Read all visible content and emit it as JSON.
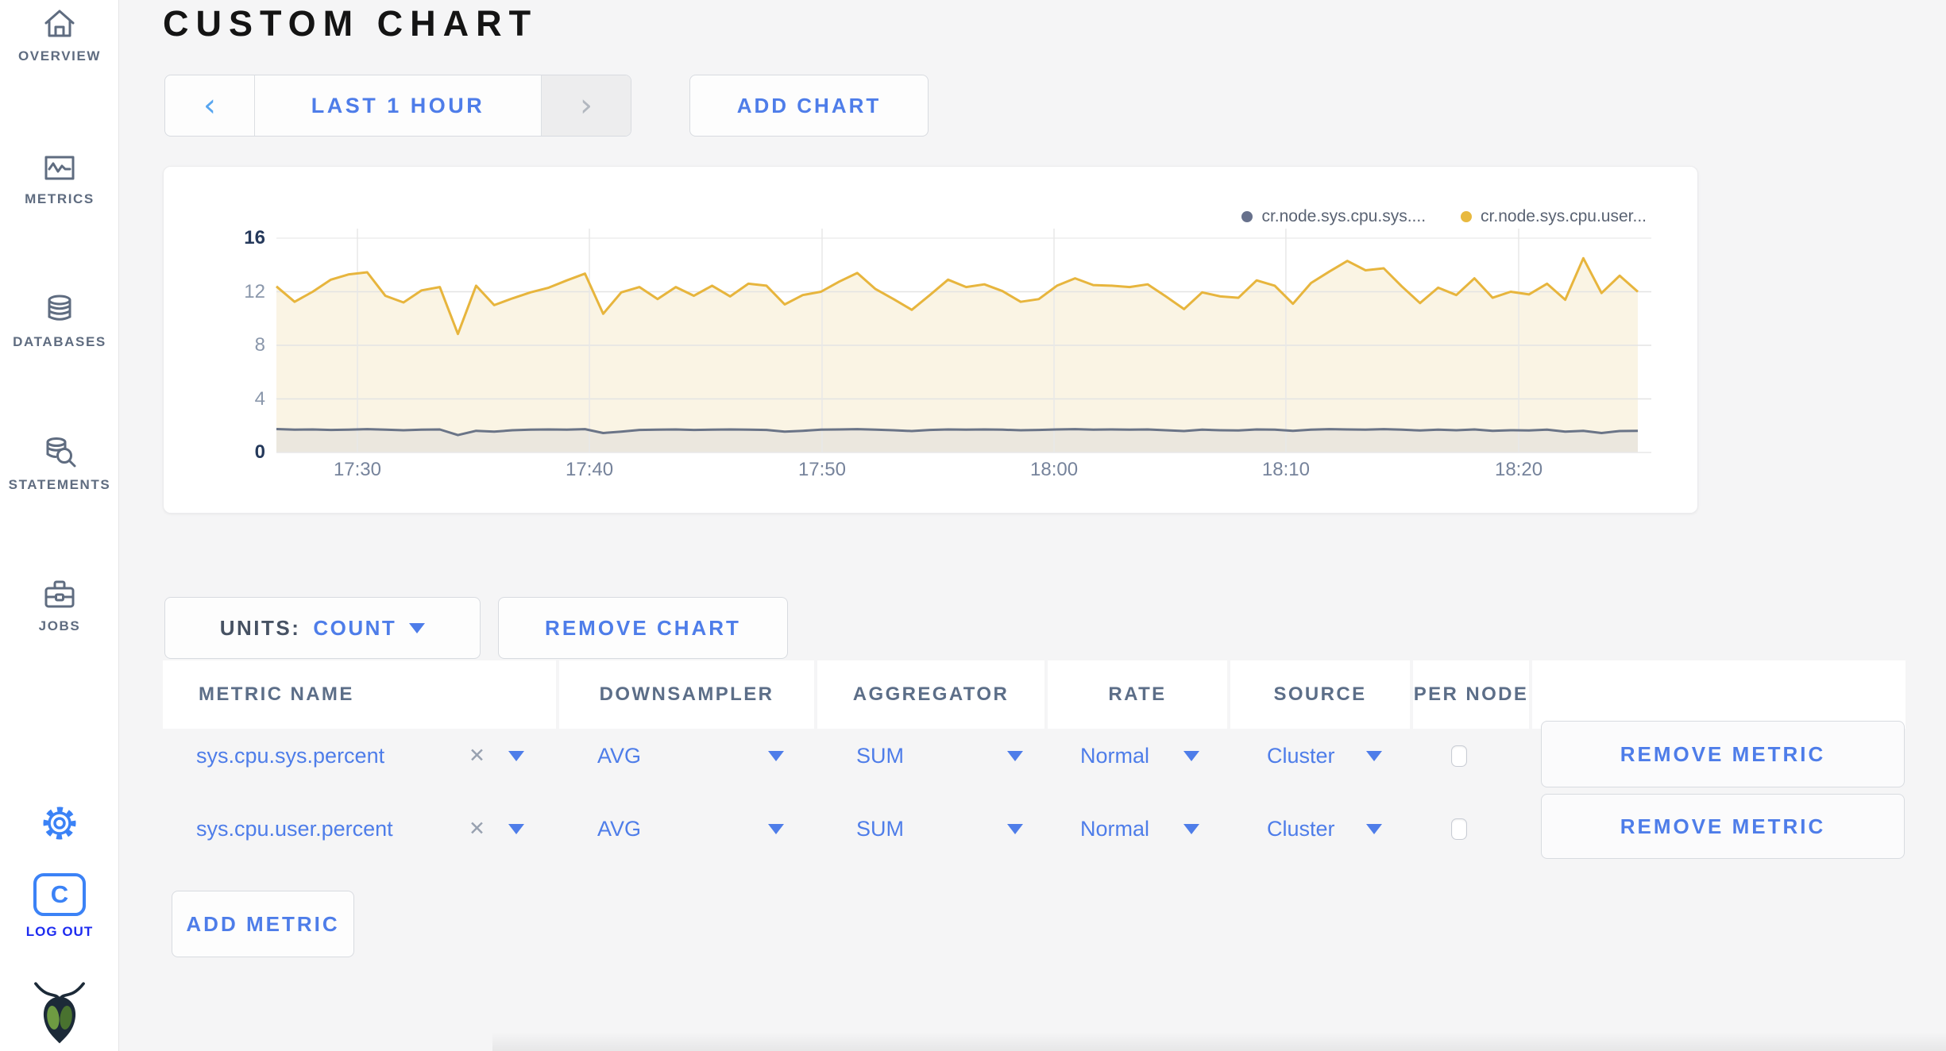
{
  "header": {
    "title": "CUSTOM CHART"
  },
  "sidebar": {
    "items": [
      {
        "label": "OVERVIEW",
        "icon": "home-icon"
      },
      {
        "label": "METRICS",
        "icon": "metrics-icon"
      },
      {
        "label": "DATABASES",
        "icon": "database-icon"
      },
      {
        "label": "STATEMENTS",
        "icon": "statements-icon"
      },
      {
        "label": "JOBS",
        "icon": "briefcase-icon"
      }
    ],
    "logout_monogram": "C",
    "logout_label": "LOG OUT"
  },
  "icons": {
    "prev_glyph": "‹",
    "next_glyph": "›",
    "remove_glyph": "✕"
  },
  "time_selector": {
    "label": "LAST 1 HOUR"
  },
  "add_chart_label": "ADD CHART",
  "units": {
    "prefix": "UNITS:",
    "value": "COUNT"
  },
  "remove_chart_label": "REMOVE CHART",
  "add_metric_label": "ADD METRIC",
  "colors": {
    "accent_blue": "#4e7de9",
    "bright_blue": "#3b82f6",
    "logout_blue": "#1d2bf0",
    "slate": "#5f6c80",
    "user_line": "#e7b53d",
    "user_fill": "#faf4e4",
    "sys_line": "#6a7487",
    "sys_fill": "#ebe7de"
  },
  "chart_data": {
    "type": "area",
    "title": "",
    "xlabel": "",
    "ylabel": "",
    "x_ticks": [
      "17:30",
      "17:40",
      "17:50",
      "18:00",
      "18:10",
      "18:20"
    ],
    "x_tick_fractions": [
      0.0595,
      0.2299,
      0.4008,
      0.5712,
      0.7415,
      0.9125
    ],
    "y_ticks": [
      0,
      4,
      8,
      12,
      16
    ],
    "ylim": [
      0,
      16
    ],
    "grid": true,
    "legend_position": "top-right",
    "series": [
      {
        "name": "cr.node.sys.cpu.sys....",
        "color": "#6a7487",
        "fill": "#ebe7de",
        "dot": "#67718c",
        "values": [
          1.75,
          1.7,
          1.72,
          1.68,
          1.7,
          1.74,
          1.7,
          1.66,
          1.7,
          1.72,
          1.3,
          1.62,
          1.55,
          1.66,
          1.7,
          1.72,
          1.7,
          1.74,
          1.45,
          1.55,
          1.68,
          1.7,
          1.72,
          1.68,
          1.7,
          1.72,
          1.7,
          1.68,
          1.55,
          1.62,
          1.7,
          1.72,
          1.74,
          1.7,
          1.66,
          1.6,
          1.68,
          1.72,
          1.7,
          1.72,
          1.7,
          1.66,
          1.68,
          1.72,
          1.74,
          1.7,
          1.72,
          1.7,
          1.72,
          1.66,
          1.6,
          1.7,
          1.66,
          1.64,
          1.72,
          1.7,
          1.62,
          1.7,
          1.74,
          1.72,
          1.7,
          1.74,
          1.7,
          1.64,
          1.7,
          1.66,
          1.72,
          1.62,
          1.66,
          1.64,
          1.7,
          1.56,
          1.62,
          1.45,
          1.6,
          1.62
        ]
      },
      {
        "name": "cr.node.sys.cpu.user...",
        "color": "#e7b53d",
        "fill": "#faf4e4",
        "dot": "#e8b93f",
        "values": [
          12.4,
          11.25,
          12.0,
          12.9,
          13.3,
          13.45,
          11.7,
          11.2,
          12.1,
          12.35,
          8.85,
          12.45,
          11.0,
          11.5,
          11.95,
          12.3,
          12.85,
          13.35,
          10.35,
          11.95,
          12.35,
          11.45,
          12.35,
          11.7,
          12.45,
          11.65,
          12.6,
          12.45,
          11.05,
          11.75,
          12.0,
          12.75,
          13.4,
          12.2,
          11.45,
          10.65,
          11.75,
          12.9,
          12.35,
          12.55,
          12.05,
          11.25,
          11.45,
          12.45,
          13.0,
          12.5,
          12.45,
          12.35,
          12.55,
          11.65,
          10.7,
          11.95,
          11.65,
          11.55,
          12.85,
          12.45,
          11.1,
          12.65,
          13.5,
          14.3,
          13.6,
          13.75,
          12.4,
          11.15,
          12.3,
          11.75,
          13.0,
          11.55,
          12.0,
          11.8,
          12.6,
          11.4,
          14.5,
          11.9,
          13.2,
          12.0
        ]
      }
    ]
  },
  "table": {
    "headers": [
      "METRIC NAME",
      "DOWNSAMPLER",
      "AGGREGATOR",
      "RATE",
      "SOURCE",
      "PER NODE",
      ""
    ],
    "rows": [
      {
        "metric": "sys.cpu.sys.percent",
        "downsampler": "AVG",
        "aggregator": "SUM",
        "rate": "Normal",
        "source": "Cluster",
        "per_node_checked": false,
        "remove_label": "REMOVE METRIC"
      },
      {
        "metric": "sys.cpu.user.percent",
        "downsampler": "AVG",
        "aggregator": "SUM",
        "rate": "Normal",
        "source": "Cluster",
        "per_node_checked": false,
        "remove_label": "REMOVE METRIC"
      }
    ]
  }
}
